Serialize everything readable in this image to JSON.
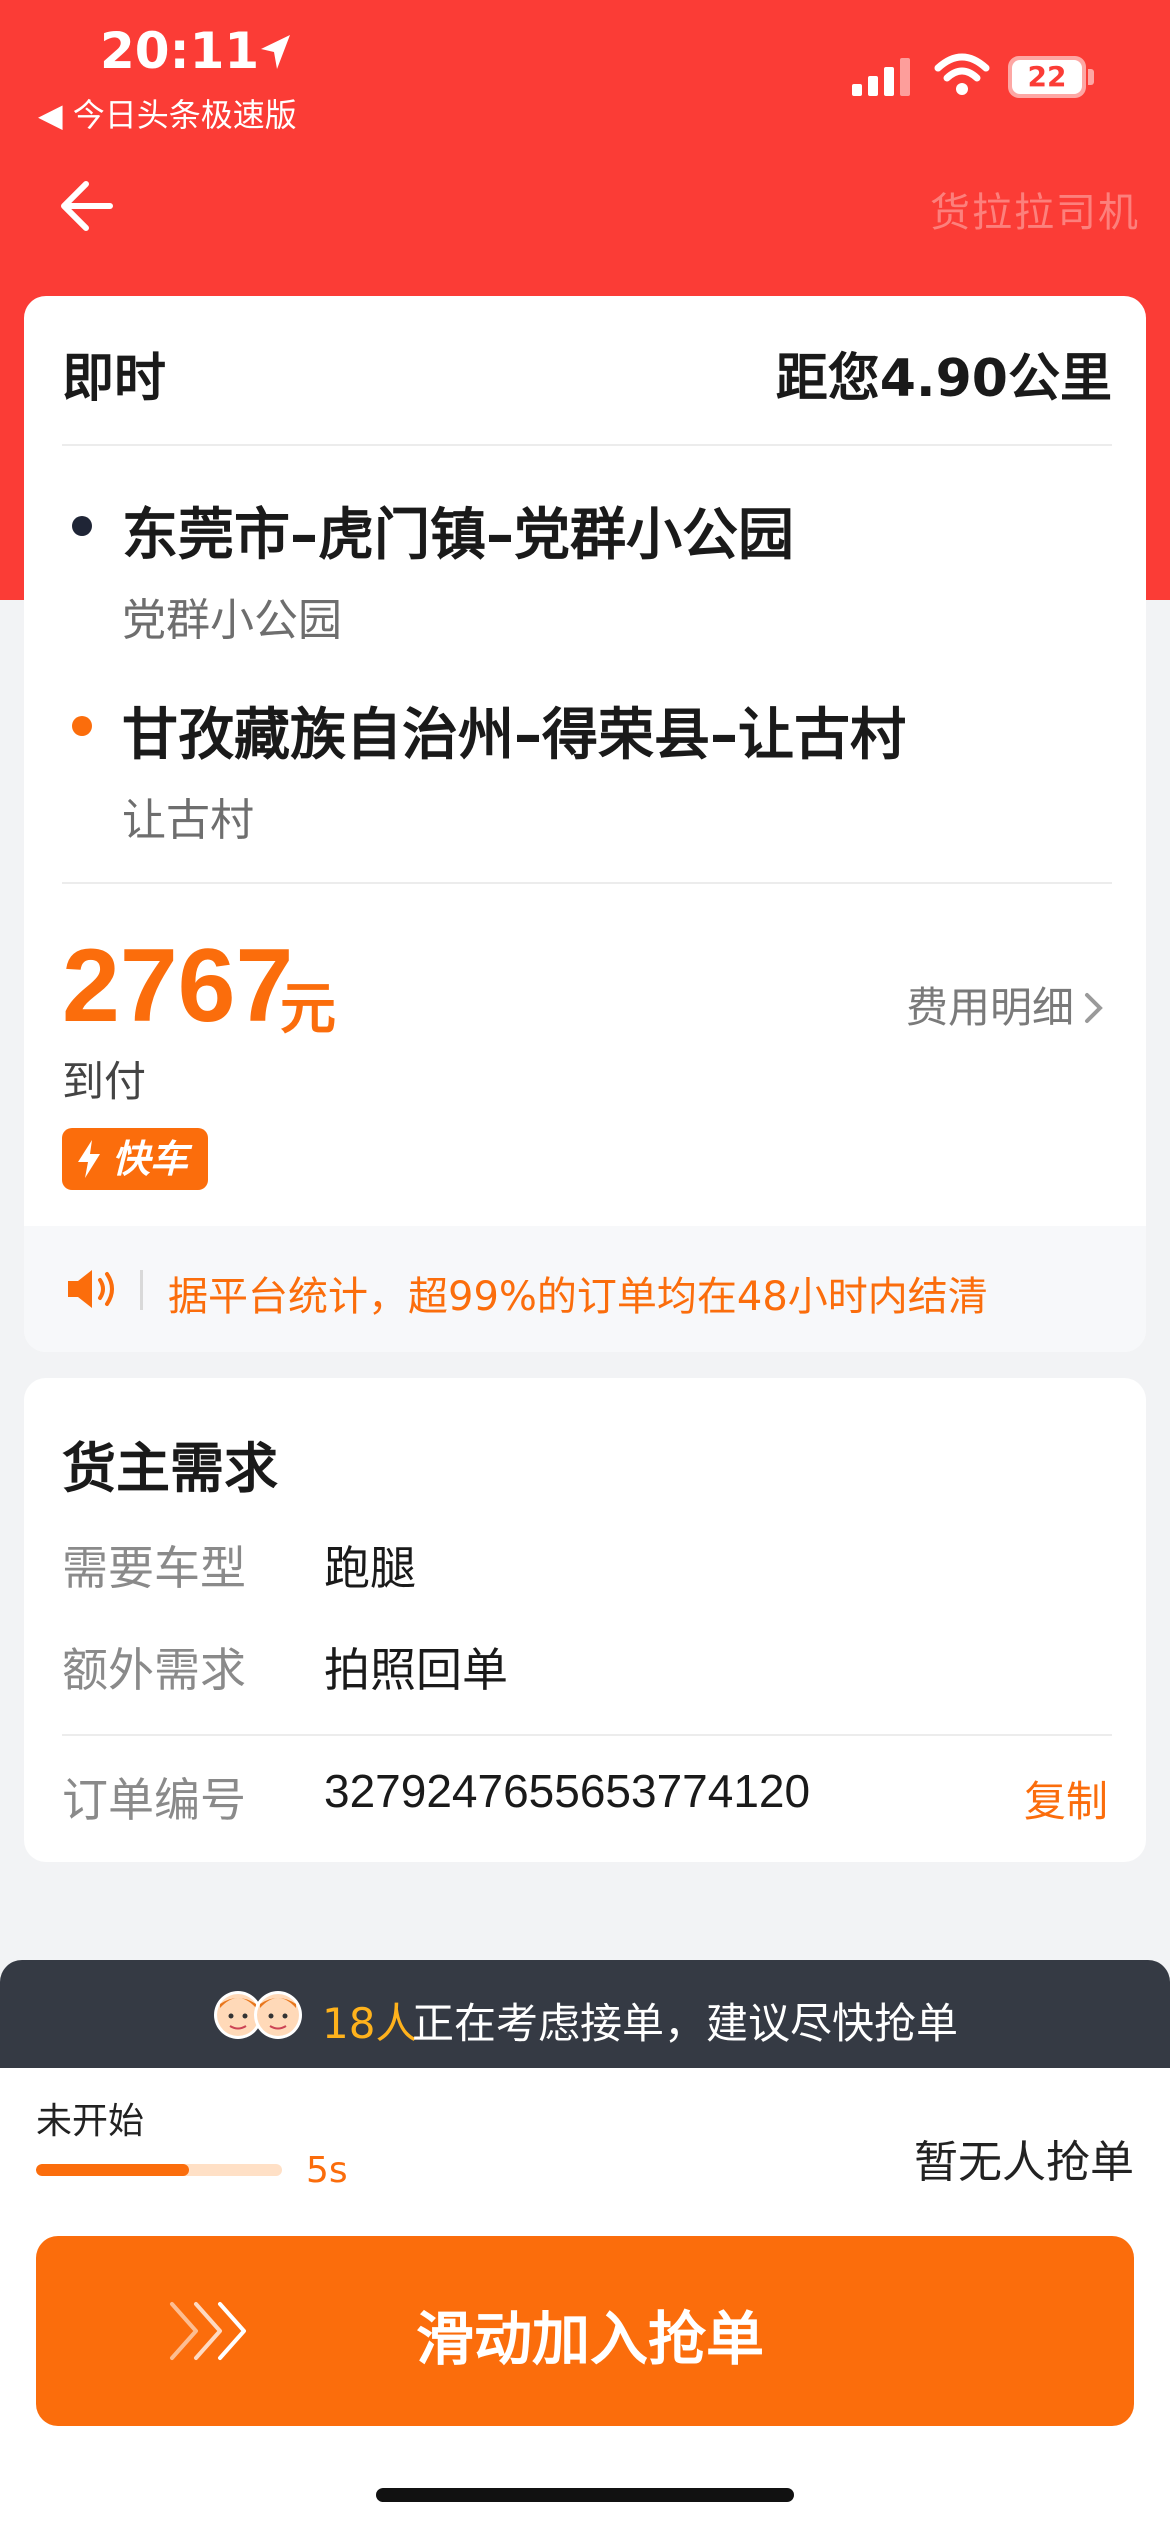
{
  "status_bar": {
    "time": "20:11",
    "back_app": "◀ 今日头条极速版",
    "battery": "22"
  },
  "header": {
    "watermark": "货拉拉司机"
  },
  "order": {
    "type": "即时",
    "distance": "距您4.90公里",
    "pickup": {
      "title": "东莞市–虎门镇–党群小公园",
      "sub": "党群小公园"
    },
    "dropoff": {
      "title": "甘孜藏族自治州–得荣县–让古村",
      "sub": "让古村"
    },
    "price": "2767",
    "price_unit": "元",
    "fee_detail": "费用明细",
    "payment": "到付",
    "car_tag": "快车",
    "notice": "据平台统计，超99%的订单均在48小时内结清"
  },
  "requirements": {
    "title": "货主需求",
    "rows": [
      {
        "label": "需要车型",
        "value": "跑腿"
      },
      {
        "label": "额外需求",
        "value": "拍照回单"
      }
    ],
    "order_no_label": "订单编号",
    "order_no": "327924765565377412​0",
    "copy": "复制"
  },
  "bottom": {
    "banner_count": "18人",
    "banner_text": "正在考虑接单，建议尽快抢单",
    "status_label": "未开始",
    "progress_percent": 62,
    "progress_time": "5s",
    "grab_status": "暂无人抢单",
    "slide_label": "滑动加入抢单"
  },
  "colors": {
    "header_red": "#fb3c36",
    "accent_orange": "#fb6d0c",
    "banner_dark": "#353a44",
    "count_yellow": "#ffb21c"
  },
  "icons": [
    "location-arrow-icon",
    "signal-icon",
    "wifi-icon",
    "battery-icon",
    "back-arrow-icon",
    "chevron-right-icon",
    "lightning-icon",
    "speaker-icon",
    "avatar-icon",
    "triple-chevron-icon"
  ]
}
